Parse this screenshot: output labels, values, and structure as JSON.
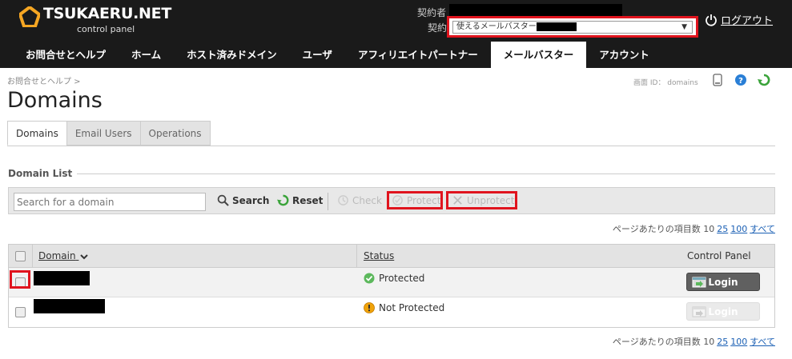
{
  "header": {
    "logo_text": "TSUKAERU.NET",
    "logo_sub": "control panel",
    "contract_holder_label": "契約者",
    "contract_label": "契約",
    "contract_select_value": "使えるメールバスター",
    "logout_label": "ログアウト"
  },
  "nav": {
    "items": [
      {
        "label": "お問合せとヘルプ"
      },
      {
        "label": "ホーム"
      },
      {
        "label": "ホスト済みドメイン"
      },
      {
        "label": "ユーザ"
      },
      {
        "label": "アフィリエイトパートナー"
      },
      {
        "label": "メールバスター"
      },
      {
        "label": "アカウント"
      }
    ],
    "active_index": 5
  },
  "breadcrumb": "お問合せとヘルプ >",
  "screen_id": "画面 ID：  domains",
  "page_title": "Domains",
  "tabs": [
    {
      "label": "Domains"
    },
    {
      "label": "Email Users"
    },
    {
      "label": "Operations"
    }
  ],
  "section_title": "Domain List",
  "toolbar": {
    "search_placeholder": "Search for a domain",
    "search_label": "Search",
    "reset_label": "Reset",
    "check_label": "Check",
    "protect_label": "Protect",
    "unprotect_label": "Unprotect"
  },
  "pagination": {
    "label": "ページあたりの項目数 10",
    "options": [
      "25",
      "100",
      "すべて"
    ]
  },
  "table": {
    "columns": {
      "domain": "Domain",
      "status": "Status",
      "control_panel": "Control Panel"
    },
    "rows": [
      {
        "status": "Protected",
        "login_label": "Login"
      },
      {
        "status": "Not Protected",
        "login_label": "Login"
      }
    ]
  },
  "colors": {
    "highlight": "#e0141e",
    "header_bg": "#1a1a1a",
    "logo_accent": "#f5a623",
    "protected": "#5cb85c",
    "not_protected": "#f0a30a"
  }
}
